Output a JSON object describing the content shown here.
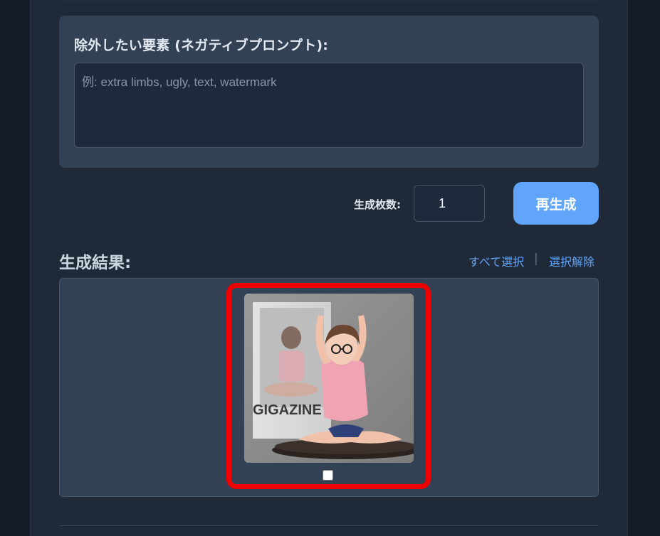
{
  "negative_prompt": {
    "label": "除外したい要素 (ネガティブプロンプト):",
    "placeholder": "例: extra limbs, ugly, text, watermark",
    "value": ""
  },
  "generation": {
    "count_label": "生成枚数:",
    "count_value": "1",
    "regenerate_label": "再生成"
  },
  "results": {
    "title": "生成結果:",
    "select_all_label": "すべて選択",
    "separator": "|",
    "deselect_label": "選択解除",
    "items": [
      {
        "image_text": "GIGAZINE",
        "selected": false,
        "highlighted": true
      }
    ]
  },
  "colors": {
    "accent": "#60a5fa",
    "highlight": "#ee0000",
    "panel": "#334155",
    "background": "#1f2937"
  }
}
